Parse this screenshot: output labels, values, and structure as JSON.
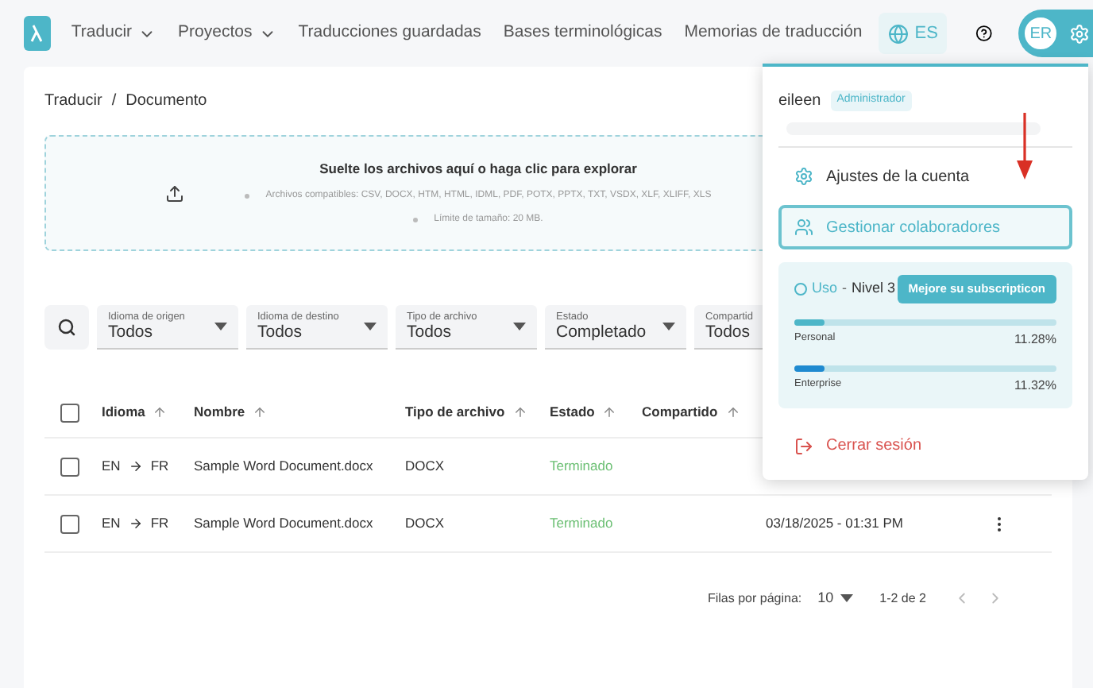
{
  "nav": {
    "items": [
      {
        "label": "Traducir",
        "has_menu": true
      },
      {
        "label": "Proyectos",
        "has_menu": true
      },
      {
        "label": "Traducciones guardadas",
        "has_menu": false
      },
      {
        "label": "Bases terminológicas",
        "has_menu": false
      },
      {
        "label": "Memorias de traducción",
        "has_menu": false
      }
    ],
    "language": "ES",
    "avatar": "ER"
  },
  "breadcrumb": [
    "Traducir",
    "/",
    "Documento"
  ],
  "upload": {
    "title": "Suelte los archivos aquí o haga clic para explorar",
    "notes": [
      "Archivos compatibles: CSV, DOCX, HTM, HTML, IDML, PDF, POTX, PPTX, TXT, VSDX, XLF, XLIFF, XLS",
      "Límite de tamaño: 20 MB."
    ]
  },
  "filters": [
    {
      "label": "Idioma de origen",
      "value": "Todos"
    },
    {
      "label": "Idioma de destino",
      "value": "Todos"
    },
    {
      "label": "Tipo de archivo",
      "value": "Todos"
    },
    {
      "label": "Estado",
      "value": "Completado"
    },
    {
      "label": "Compartid",
      "value": "Todos"
    }
  ],
  "table": {
    "all_checked": false,
    "columns": [
      "Idioma",
      "Nombre",
      "Tipo de archivo",
      "Estado",
      "Compartido"
    ],
    "rows": [
      {
        "checked": false,
        "source": "EN",
        "target": "FR",
        "name": "Sample Word Document.docx",
        "type": "DOCX",
        "status": "Terminado"
      },
      {
        "checked": false,
        "source": "EN",
        "target": "FR",
        "name": "Sample Word Document.docx",
        "type": "DOCX",
        "status": "Terminado",
        "date": "03/18/2025 - 01:31 PM"
      }
    ]
  },
  "pagination": {
    "label": "Filas por página:",
    "per_page": "10",
    "range": "1-2 de 2"
  },
  "account_menu": {
    "user": "eileen",
    "role": "Administrador",
    "items": [
      {
        "kind": "settings",
        "label": "Ajustes de la cuenta",
        "selected": false
      },
      {
        "kind": "collaborators",
        "label": "Gestionar colaboradores",
        "selected": true
      }
    ],
    "usage": {
      "title": "Uso",
      "separator": "-",
      "plan": "Nivel 3",
      "upgrade": "Mejore su subscripticon",
      "meters": [
        {
          "name": "Personal",
          "level": 0.1128,
          "reading": "11.28%",
          "color": "#4db6c8"
        },
        {
          "name": "Enterprise",
          "level": 0.1132,
          "reading": "11.32%",
          "color": "#1f8ad0"
        }
      ]
    },
    "logout": "Cerrar sesión"
  }
}
